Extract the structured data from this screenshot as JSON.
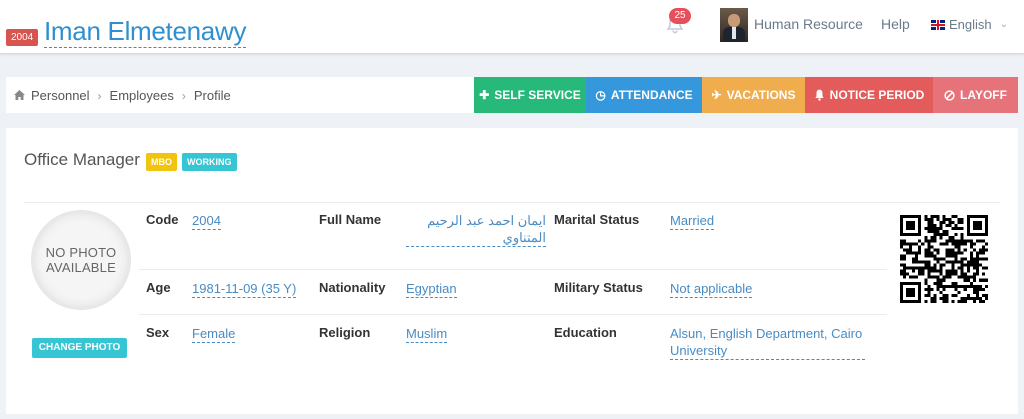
{
  "header": {
    "employee_code_badge": "2004",
    "employee_name": "Iman Elmetenawy",
    "notification_count": "25",
    "user_role": "Human Resource",
    "help": "Help",
    "language": "English"
  },
  "breadcrumb": {
    "items": [
      "Personnel",
      "Employees",
      "Profile"
    ]
  },
  "actions": [
    {
      "label": "SELF SERVICE",
      "icon": "plus-icon",
      "color": "#26b979"
    },
    {
      "label": "ATTENDANCE",
      "icon": "clock-icon",
      "color": "#3598dc"
    },
    {
      "label": "VACATIONS",
      "icon": "plane-icon",
      "color": "#f0ad4e"
    },
    {
      "label": "NOTICE PERIOD",
      "icon": "bell-icon",
      "color": "#e35b5a"
    },
    {
      "label": "LAYOFF",
      "icon": "ban-icon",
      "color": "#e7737a"
    }
  ],
  "profile": {
    "job_title": "Office Manager",
    "tags": [
      "MBO",
      "WORKING"
    ],
    "photo_placeholder_line1": "NO PHOTO",
    "photo_placeholder_line2": "AVAILABLE",
    "change_photo": "CHANGE PHOTO",
    "fields": {
      "code": {
        "label": "Code",
        "value": "2004"
      },
      "full_name": {
        "label": "Full Name",
        "value": "ايمان احمد عبد الرحيم المتناوي"
      },
      "marital_status": {
        "label": "Marital Status",
        "value": "Married"
      },
      "age": {
        "label": "Age",
        "value": "1981-11-09 (35 Y)"
      },
      "nationality": {
        "label": "Nationality",
        "value": "Egyptian"
      },
      "military_status": {
        "label": "Military Status",
        "value": "Not applicable"
      },
      "sex": {
        "label": "Sex",
        "value": "Female"
      },
      "religion": {
        "label": "Religion",
        "value": "Muslim"
      },
      "education": {
        "label": "Education",
        "value": "Alsun, English Department, Cairo University"
      }
    }
  }
}
